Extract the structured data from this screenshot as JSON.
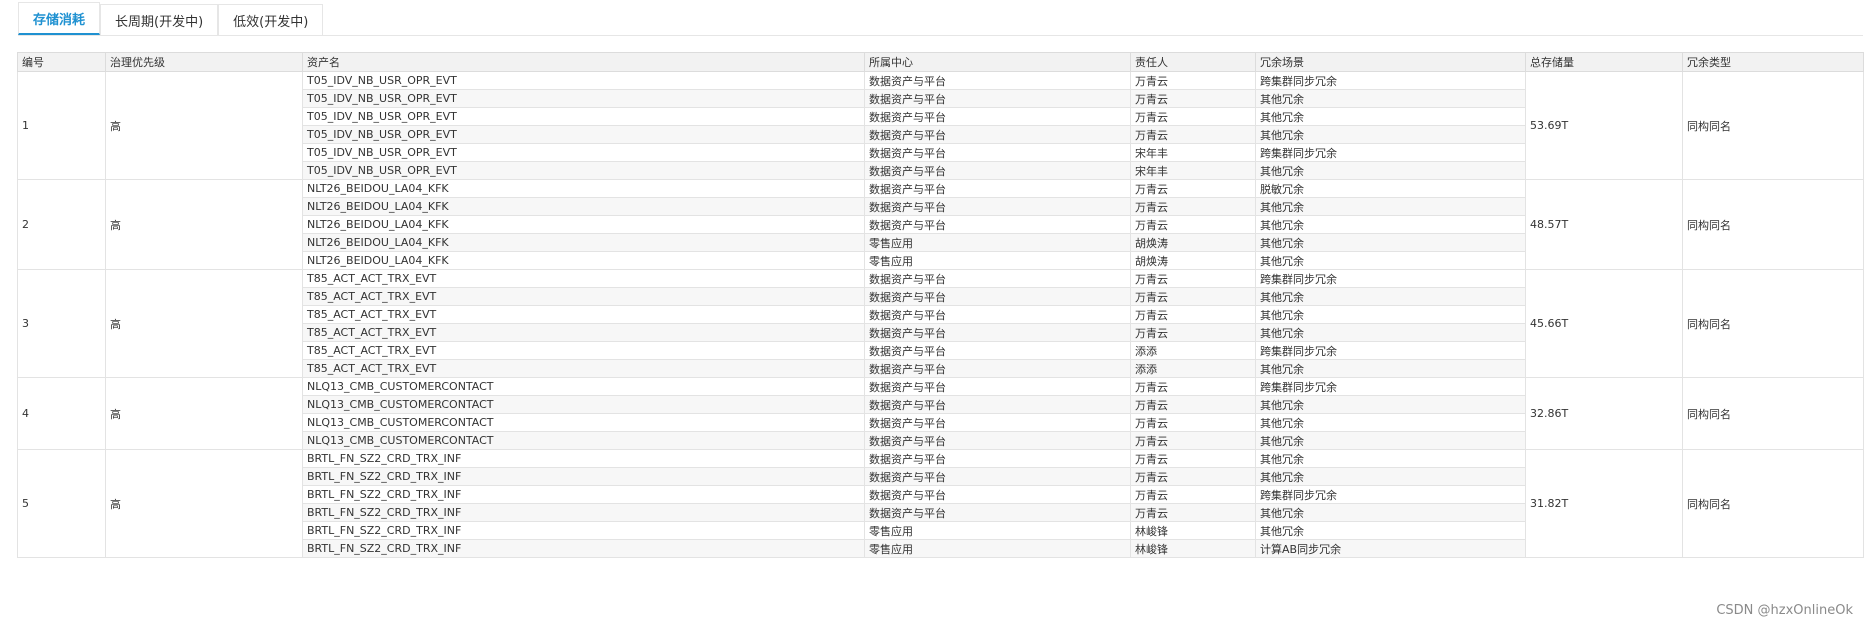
{
  "tabs": [
    {
      "label": "存储消耗",
      "active": true
    },
    {
      "label": "长周期(开发中)",
      "active": false
    },
    {
      "label": "低效(开发中)",
      "active": false
    }
  ],
  "table": {
    "headers": [
      "编号",
      "治理优先级",
      "资产名",
      "所属中心",
      "责任人",
      "冗余场景",
      "总存储量",
      "冗余类型"
    ],
    "groups": [
      {
        "id": "1",
        "priority": "高",
        "storage": "53.69T",
        "type": "同构同名",
        "rows": [
          {
            "asset": "T05_IDV_NB_USR_OPR_EVT",
            "center": "数据资产与平台",
            "owner": "万青云",
            "scene": "跨集群同步冗余"
          },
          {
            "asset": "T05_IDV_NB_USR_OPR_EVT",
            "center": "数据资产与平台",
            "owner": "万青云",
            "scene": "其他冗余"
          },
          {
            "asset": "T05_IDV_NB_USR_OPR_EVT",
            "center": "数据资产与平台",
            "owner": "万青云",
            "scene": "其他冗余"
          },
          {
            "asset": "T05_IDV_NB_USR_OPR_EVT",
            "center": "数据资产与平台",
            "owner": "万青云",
            "scene": "其他冗余"
          },
          {
            "asset": "T05_IDV_NB_USR_OPR_EVT",
            "center": "数据资产与平台",
            "owner": "宋年丰",
            "scene": "跨集群同步冗余"
          },
          {
            "asset": "T05_IDV_NB_USR_OPR_EVT",
            "center": "数据资产与平台",
            "owner": "宋年丰",
            "scene": "其他冗余"
          }
        ]
      },
      {
        "id": "2",
        "priority": "高",
        "storage": "48.57T",
        "type": "同构同名",
        "rows": [
          {
            "asset": "NLT26_BEIDOU_LA04_KFK",
            "center": "数据资产与平台",
            "owner": "万青云",
            "scene": "脱敏冗余"
          },
          {
            "asset": "NLT26_BEIDOU_LA04_KFK",
            "center": "数据资产与平台",
            "owner": "万青云",
            "scene": "其他冗余"
          },
          {
            "asset": "NLT26_BEIDOU_LA04_KFK",
            "center": "数据资产与平台",
            "owner": "万青云",
            "scene": "其他冗余"
          },
          {
            "asset": "NLT26_BEIDOU_LA04_KFK",
            "center": "零售应用",
            "owner": "胡焕涛",
            "scene": "其他冗余"
          },
          {
            "asset": "NLT26_BEIDOU_LA04_KFK",
            "center": "零售应用",
            "owner": "胡焕涛",
            "scene": "其他冗余"
          }
        ]
      },
      {
        "id": "3",
        "priority": "高",
        "storage": "45.66T",
        "type": "同构同名",
        "rows": [
          {
            "asset": "T85_ACT_ACT_TRX_EVT",
            "center": "数据资产与平台",
            "owner": "万青云",
            "scene": "跨集群同步冗余"
          },
          {
            "asset": "T85_ACT_ACT_TRX_EVT",
            "center": "数据资产与平台",
            "owner": "万青云",
            "scene": "其他冗余"
          },
          {
            "asset": "T85_ACT_ACT_TRX_EVT",
            "center": "数据资产与平台",
            "owner": "万青云",
            "scene": "其他冗余"
          },
          {
            "asset": "T85_ACT_ACT_TRX_EVT",
            "center": "数据资产与平台",
            "owner": "万青云",
            "scene": "其他冗余"
          },
          {
            "asset": "T85_ACT_ACT_TRX_EVT",
            "center": "数据资产与平台",
            "owner": "添添",
            "scene": "跨集群同步冗余"
          },
          {
            "asset": "T85_ACT_ACT_TRX_EVT",
            "center": "数据资产与平台",
            "owner": "添添",
            "scene": "其他冗余"
          }
        ]
      },
      {
        "id": "4",
        "priority": "高",
        "storage": "32.86T",
        "type": "同构同名",
        "rows": [
          {
            "asset": "NLQ13_CMB_CUSTOMERCONTACT",
            "center": "数据资产与平台",
            "owner": "万青云",
            "scene": "跨集群同步冗余"
          },
          {
            "asset": "NLQ13_CMB_CUSTOMERCONTACT",
            "center": "数据资产与平台",
            "owner": "万青云",
            "scene": "其他冗余"
          },
          {
            "asset": "NLQ13_CMB_CUSTOMERCONTACT",
            "center": "数据资产与平台",
            "owner": "万青云",
            "scene": "其他冗余"
          },
          {
            "asset": "NLQ13_CMB_CUSTOMERCONTACT",
            "center": "数据资产与平台",
            "owner": "万青云",
            "scene": "其他冗余"
          }
        ]
      },
      {
        "id": "5",
        "priority": "高",
        "storage": "31.82T",
        "type": "同构同名",
        "rows": [
          {
            "asset": "BRTL_FN_SZ2_CRD_TRX_INF",
            "center": "数据资产与平台",
            "owner": "万青云",
            "scene": "其他冗余"
          },
          {
            "asset": "BRTL_FN_SZ2_CRD_TRX_INF",
            "center": "数据资产与平台",
            "owner": "万青云",
            "scene": "其他冗余"
          },
          {
            "asset": "BRTL_FN_SZ2_CRD_TRX_INF",
            "center": "数据资产与平台",
            "owner": "万青云",
            "scene": "跨集群同步冗余"
          },
          {
            "asset": "BRTL_FN_SZ2_CRD_TRX_INF",
            "center": "数据资产与平台",
            "owner": "万青云",
            "scene": "其他冗余"
          },
          {
            "asset": "BRTL_FN_SZ2_CRD_TRX_INF",
            "center": "零售应用",
            "owner": "林峻锋",
            "scene": "其他冗余"
          },
          {
            "asset": "BRTL_FN_SZ2_CRD_TRX_INF",
            "center": "零售应用",
            "owner": "林峻锋",
            "scene": "计算AB同步冗余"
          }
        ]
      }
    ]
  },
  "watermark": "CSDN @hzxOnlineOk"
}
